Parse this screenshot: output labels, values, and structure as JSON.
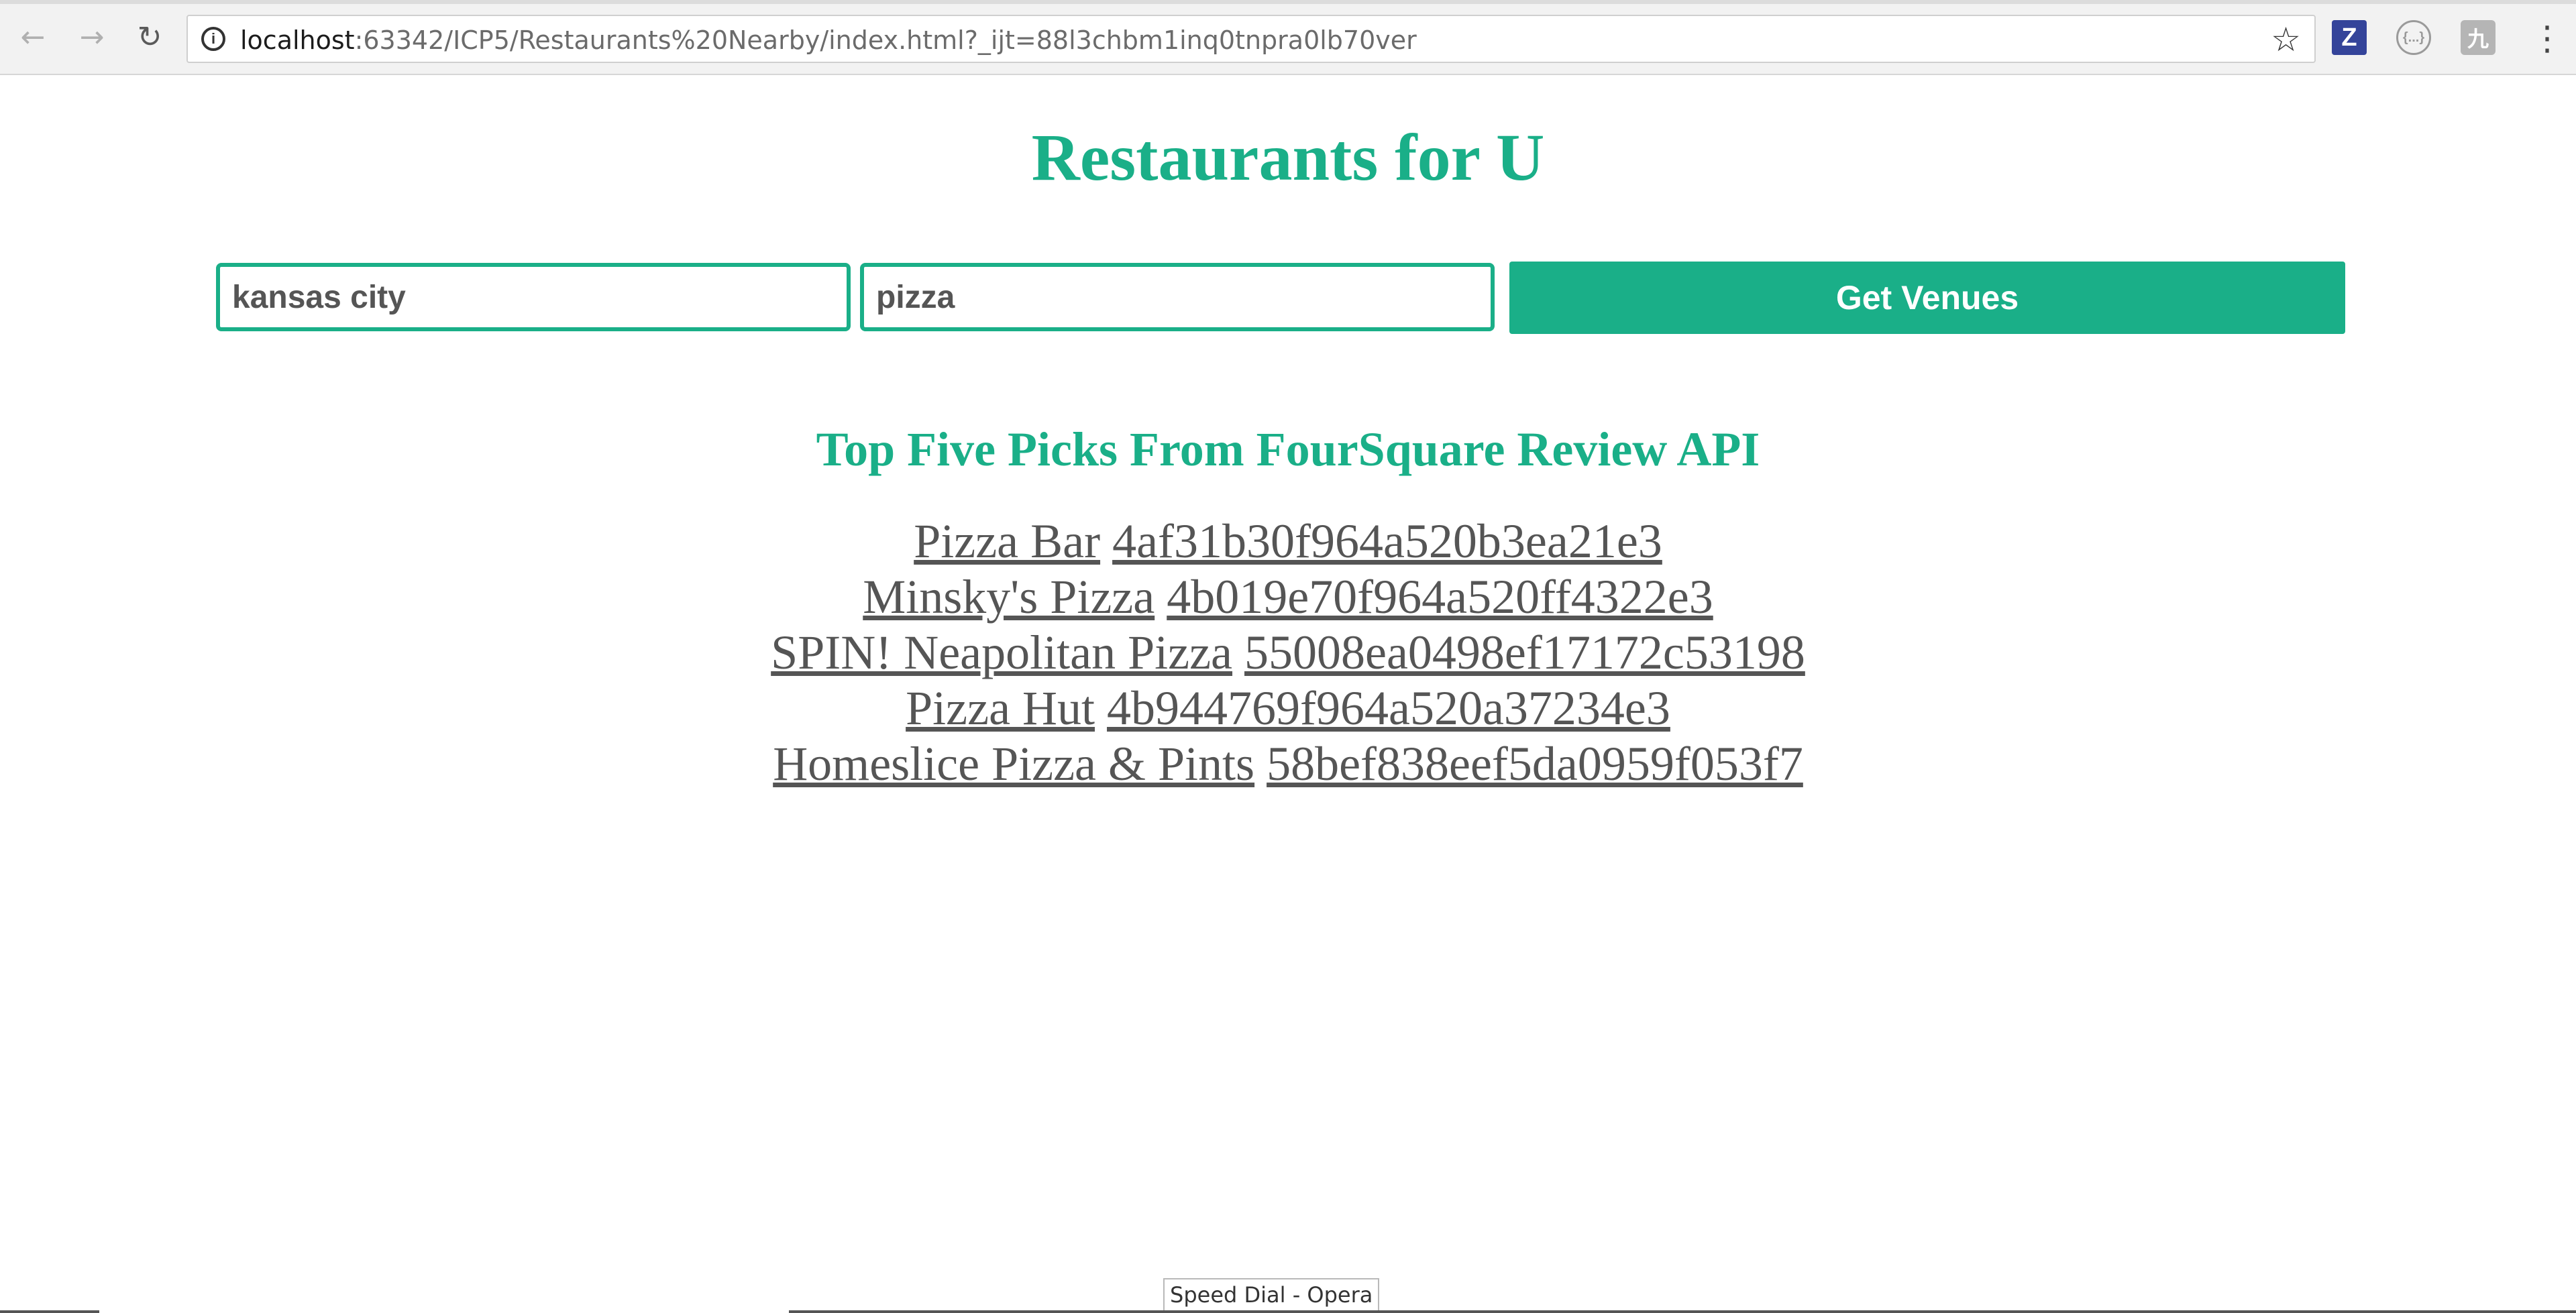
{
  "browser": {
    "url_host": "localhost",
    "url_rest": ":63342/ICP5/Restaurants%20Nearby/index.html?_ijt=88l3chbm1inq0tnpra0lb70ver",
    "info_icon_glyph": "i",
    "extensions": [
      {
        "name": "z-extension-icon",
        "glyph": "Z"
      },
      {
        "name": "code-extension-icon",
        "glyph": "{...}"
      },
      {
        "name": "gray-extension-icon",
        "glyph": "九"
      }
    ],
    "status_tooltip": "Speed Dial - Opera"
  },
  "page": {
    "title": "Restaurants for U",
    "accent_color": "#1aaf88",
    "search": {
      "city_value": "kansas city",
      "query_value": "pizza",
      "button_label": "Get Venues"
    },
    "results_title": "Top Five Picks From FourSquare Review API",
    "results": [
      {
        "name": "Pizza Bar",
        "id": "4af31b30f964a520b3ea21e3"
      },
      {
        "name": "Minsky's Pizza",
        "id": "4b019e70f964a520ff4322e3"
      },
      {
        "name": "SPIN! Neapolitan Pizza",
        "id": "55008ea0498ef17172c53198"
      },
      {
        "name": "Pizza Hut",
        "id": "4b944769f964a520a37234e3"
      },
      {
        "name": "Homeslice Pizza & Pints",
        "id": "58bef838eef5da0959f053f7"
      }
    ]
  }
}
